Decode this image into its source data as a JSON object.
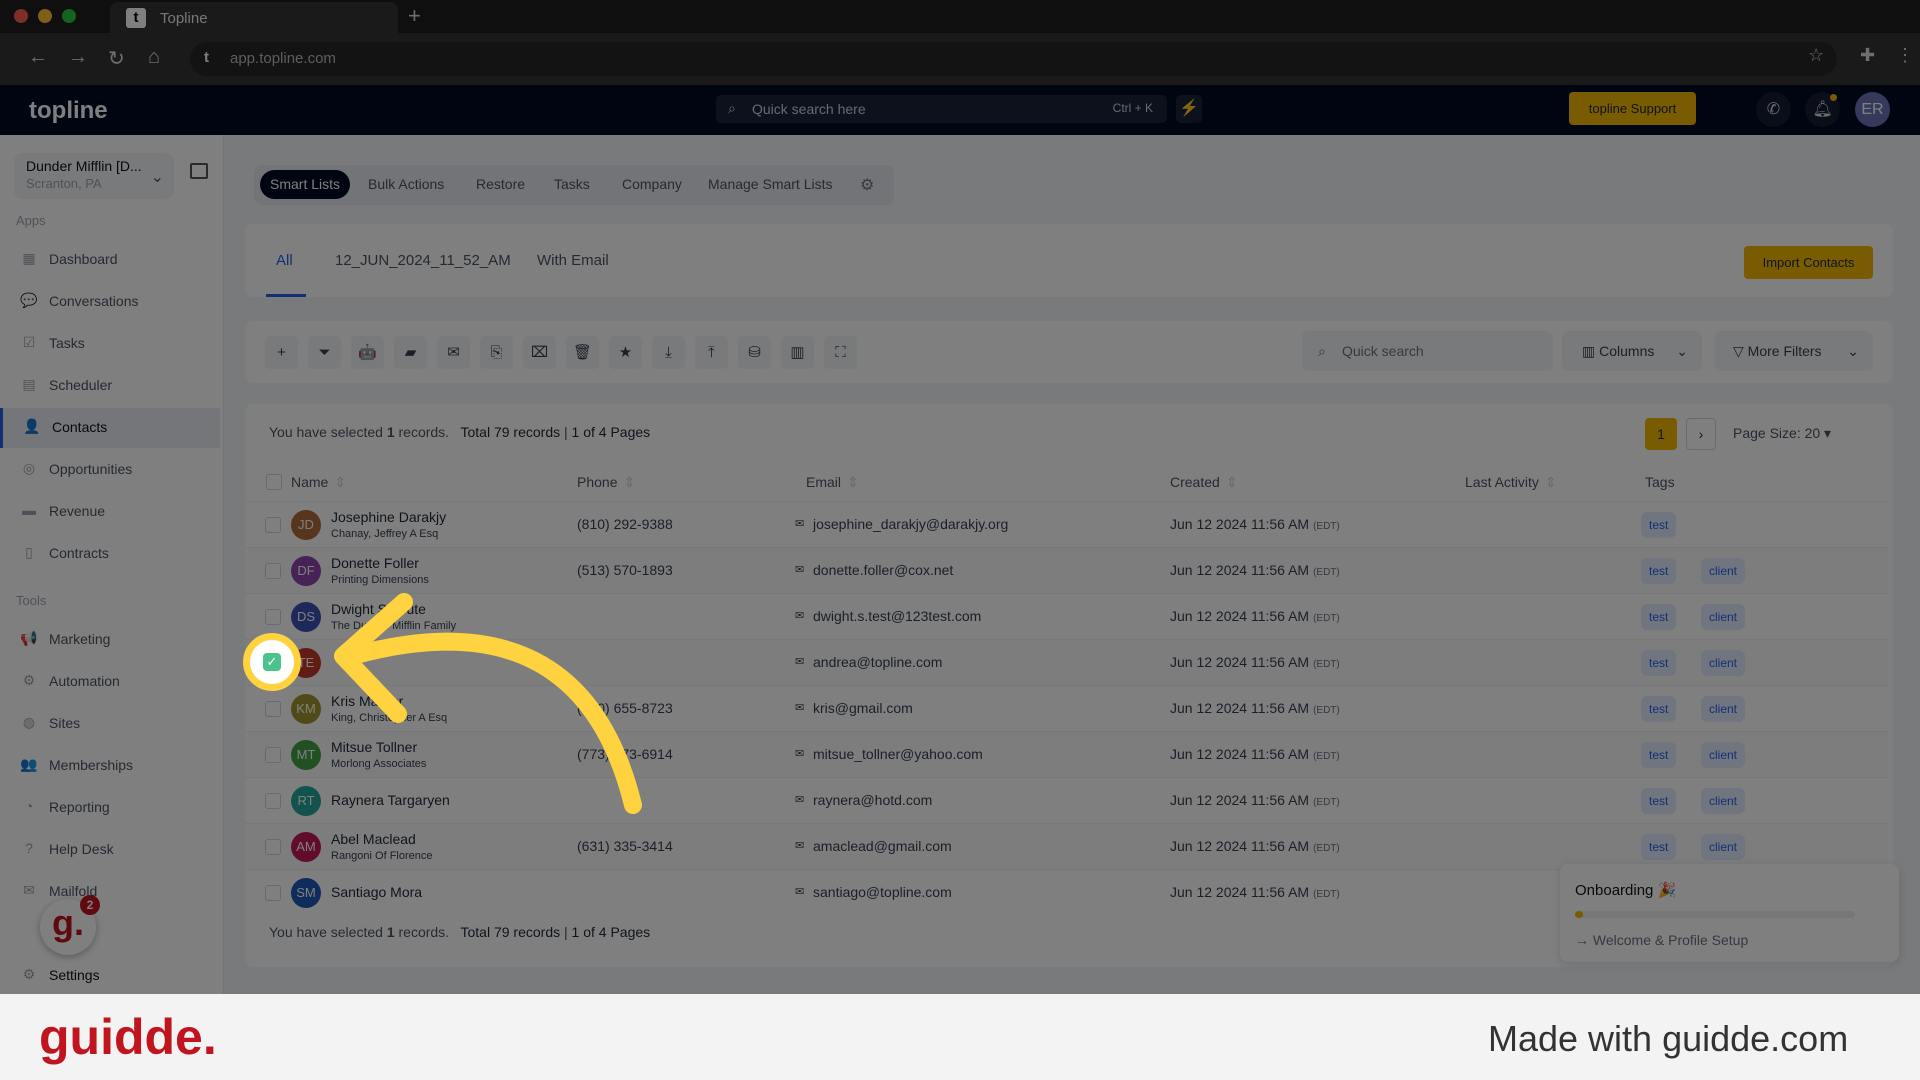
{
  "browser": {
    "tab_title": "Topline",
    "url": "app.topline.com"
  },
  "header": {
    "logo": "topline",
    "search_placeholder": "Quick search here",
    "search_shortcut": "Ctrl + K",
    "support_label": "topline Support",
    "avatar": "ER"
  },
  "account": {
    "name": "Dunder Mifflin [D...",
    "location": "Scranton, PA"
  },
  "sidebar": {
    "apps_label": "Apps",
    "tools_label": "Tools",
    "apps": [
      {
        "label": "Dashboard",
        "icon": "▦"
      },
      {
        "label": "Conversations",
        "icon": "💬"
      },
      {
        "label": "Tasks",
        "icon": "☑"
      },
      {
        "label": "Scheduler",
        "icon": "▤"
      },
      {
        "label": "Contacts",
        "icon": "👤",
        "active": true
      },
      {
        "label": "Opportunities",
        "icon": "◎"
      },
      {
        "label": "Revenue",
        "icon": "▬"
      },
      {
        "label": "Contracts",
        "icon": "▯"
      }
    ],
    "tools": [
      {
        "label": "Marketing",
        "icon": "📢"
      },
      {
        "label": "Automation",
        "icon": "⚙"
      },
      {
        "label": "Sites",
        "icon": "◍"
      },
      {
        "label": "Memberships",
        "icon": "👥"
      },
      {
        "label": "Reporting",
        "icon": "◔"
      },
      {
        "label": "Help Desk",
        "icon": "?"
      },
      {
        "label": "Mailfold",
        "icon": "✉"
      }
    ],
    "settings": "Settings"
  },
  "subnav": [
    "Smart Lists",
    "Bulk Actions",
    "Restore",
    "Tasks",
    "Company",
    "Manage Smart Lists"
  ],
  "list_tabs": [
    "All",
    "12_JUN_2024_11_52_AM",
    "With Email"
  ],
  "import_label": "Import Contacts",
  "toolbar": {
    "icons": [
      "+",
      "⏷",
      "🤖",
      "▰",
      "✉",
      "⎘",
      "⌧",
      "🗑",
      "★",
      "⤓",
      "⤒",
      "⛁",
      "▥",
      "⛶"
    ],
    "search_placeholder": "Quick search",
    "columns_label": "Columns",
    "filters_label": "More Filters"
  },
  "summary": {
    "selected_prefix": "You have selected",
    "selected_count": "1",
    "selected_suffix": "records.",
    "total": "Total 79 records",
    "pages": "1 of 4 Pages"
  },
  "pagination": {
    "current": "1",
    "page_size": "Page Size: 20"
  },
  "columns": [
    "Name",
    "Phone",
    "Email",
    "Created",
    "Last Activity",
    "Tags"
  ],
  "rows": [
    {
      "initials": "JD",
      "color": "#b06a3b",
      "name": "Josephine Darakjy",
      "company": "Chanay, Jeffrey A Esq",
      "phone": "(810) 292-9388",
      "email": "josephine_darakjy@darakjy.org",
      "created": "Jun 12 2024 11:56 AM",
      "tz": "(EDT)",
      "tags": [
        "test"
      ]
    },
    {
      "initials": "DF",
      "color": "#8e44ad",
      "name": "Donette Foller",
      "company": "Printing Dimensions",
      "phone": "(513) 570-1893",
      "email": "donette.foller@cox.net",
      "created": "Jun 12 2024 11:56 AM",
      "tz": "(EDT)",
      "tags": [
        "test",
        "client"
      ]
    },
    {
      "initials": "DS",
      "color": "#3f51b5",
      "name": "Dwight Schrute",
      "company": "The Dunder Mifflin Family",
      "phone": "",
      "email": "dwight.s.test@123test.com",
      "created": "Jun 12 2024 11:56 AM",
      "tz": "(EDT)",
      "tags": [
        "test",
        "client"
      ]
    },
    {
      "initials": "TE",
      "color": "#c0392b",
      "name": "",
      "company": "",
      "phone": "",
      "email": "andrea@topline.com",
      "created": "Jun 12 2024 11:56 AM",
      "tz": "(EDT)",
      "tags": [
        "test",
        "client"
      ],
      "checked": true
    },
    {
      "initials": "KM",
      "color": "#a0962c",
      "name": "Kris Marrier",
      "company": "King, Christopher A Esq",
      "phone": "(410) 655-8723",
      "email": "kris@gmail.com",
      "created": "Jun 12 2024 11:56 AM",
      "tz": "(EDT)",
      "tags": [
        "test",
        "client"
      ]
    },
    {
      "initials": "MT",
      "color": "#43a047",
      "name": "Mitsue Tollner",
      "company": "Morlong Associates",
      "phone": "(773) 573-6914",
      "email": "mitsue_tollner@yahoo.com",
      "created": "Jun 12 2024 11:56 AM",
      "tz": "(EDT)",
      "tags": [
        "test",
        "client"
      ]
    },
    {
      "initials": "RT",
      "color": "#26a69a",
      "name": "Raynera Targaryen",
      "company": "",
      "phone": "",
      "email": "raynera@hotd.com",
      "created": "Jun 12 2024 11:56 AM",
      "tz": "(EDT)",
      "tags": [
        "test",
        "client"
      ]
    },
    {
      "initials": "AM",
      "color": "#c2185b",
      "name": "Abel Maclead",
      "company": "Rangoni Of Florence",
      "phone": "(631) 335-3414",
      "email": "amaclead@gmail.com",
      "created": "Jun 12 2024 11:56 AM",
      "tz": "(EDT)",
      "tags": [
        "test",
        "client"
      ]
    },
    {
      "initials": "SM",
      "color": "#1e5bb8",
      "name": "Santiago Mora",
      "company": "",
      "phone": "",
      "email": "santiago@topline.com",
      "created": "Jun 12 2024 11:56 AM",
      "tz": "(EDT)",
      "tags": []
    }
  ],
  "onboarding": {
    "title": "Onboarding 🎉",
    "progress": 0.03,
    "step": "Welcome & Profile Setup"
  },
  "guidde_badge": {
    "letter": "g.",
    "count": "2"
  },
  "footer": {
    "logo": "guidde.",
    "tagline": "Made with guidde.com"
  },
  "colors": {
    "accent": "#f2b705",
    "brand_dark": "#010a24",
    "highlight": "#ffd23f",
    "check": "#4cc38a",
    "guidde_red": "#c0151f"
  }
}
